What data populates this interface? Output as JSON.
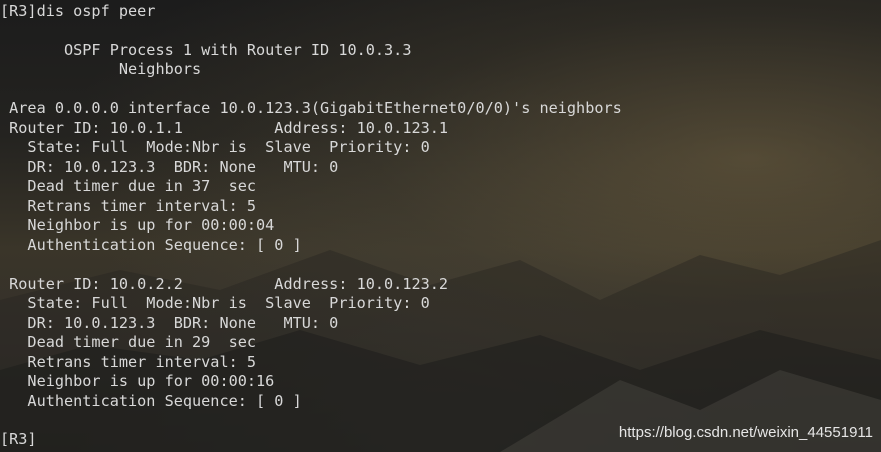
{
  "terminal": {
    "lines": [
      "[R3]dis ospf peer",
      "",
      "       OSPF Process 1 with Router ID 10.0.3.3",
      "             Neighbors",
      "",
      " Area 0.0.0.0 interface 10.0.123.3(GigabitEthernet0/0/0)'s neighbors",
      " Router ID: 10.0.1.1          Address: 10.0.123.1",
      "   State: Full  Mode:Nbr is  Slave  Priority: 0",
      "   DR: 10.0.123.3  BDR: None   MTU: 0",
      "   Dead timer due in 37  sec",
      "   Retrans timer interval: 5",
      "   Neighbor is up for 00:00:04",
      "   Authentication Sequence: [ 0 ]",
      "",
      " Router ID: 10.0.2.2          Address: 10.0.123.2",
      "   State: Full  Mode:Nbr is  Slave  Priority: 0",
      "   DR: 10.0.123.3  BDR: None   MTU: 0",
      "   Dead timer due in 29  sec",
      "   Retrans timer interval: 5",
      "   Neighbor is up for 00:00:16",
      "   Authentication Sequence: [ 0 ]",
      "",
      "[R3]"
    ]
  },
  "watermark": "https://blog.csdn.net/weixin_44551911",
  "colors": {
    "text": "#d8d8d8",
    "background": "#2a2926"
  }
}
